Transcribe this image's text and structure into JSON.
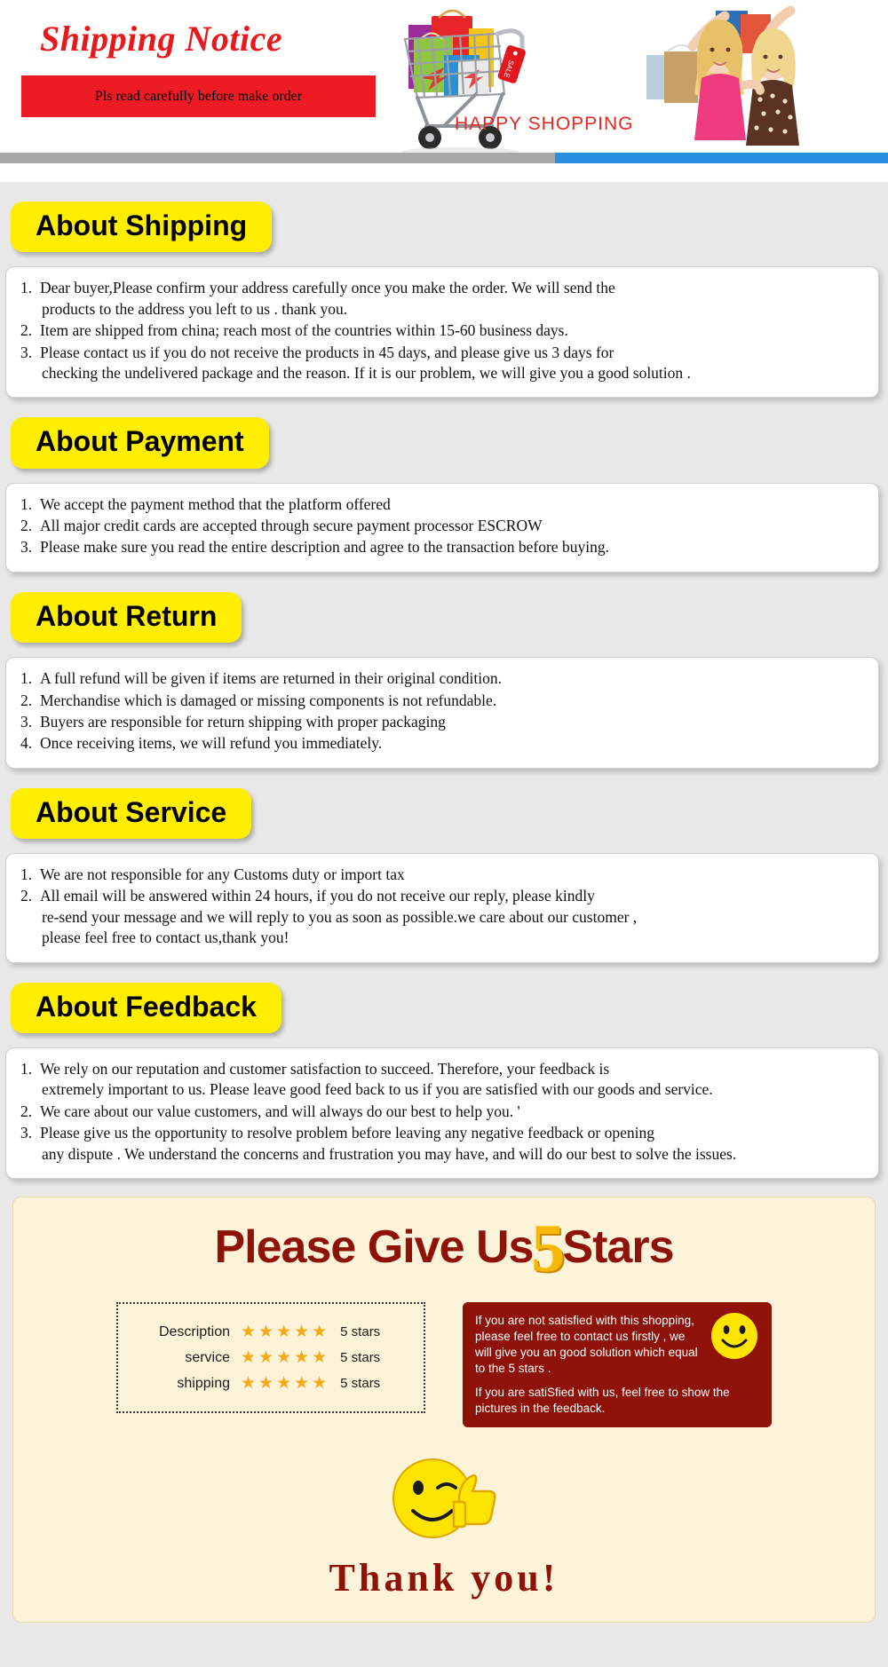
{
  "header": {
    "title": "Shipping Notice",
    "banner_text": "Pls read carefully before make order",
    "happy_shopping": "HAPPY SHOPPING",
    "sale_tag": "SALE",
    "colors": {
      "title_red": "#e8191c",
      "banner_red": "#ed1c24",
      "strip_grey": "#a8a8a8",
      "strip_blue": "#2a8fe0"
    }
  },
  "sections": [
    {
      "heading": "About Shipping",
      "items": [
        [
          "Dear buyer,Please confirm your address carefully once you make the order. We will send the",
          "products to the address you left to us . thank you."
        ],
        [
          "Item are shipped from china; reach most of the countries within 15-60 business days."
        ],
        [
          "Please contact us if you do not receive the products in 45 days, and please give us 3 days for",
          "checking the undelivered package and the reason. If it is our problem, we will give you a good solution ."
        ]
      ]
    },
    {
      "heading": "About Payment",
      "items": [
        [
          "We accept the payment method that the platform offered"
        ],
        [
          "All major credit cards are accepted through secure payment processor ESCROW"
        ],
        [
          "Please make sure you read the entire description and agree to the transaction before buying."
        ]
      ]
    },
    {
      "heading": "About Return",
      "items": [
        [
          "A full refund will be given if items are returned in their original condition."
        ],
        [
          "Merchandise which is damaged or missing components is not refundable."
        ],
        [
          "Buyers are responsible for return shipping with proper packaging"
        ],
        [
          "Once receiving items, we will refund you immediately."
        ]
      ]
    },
    {
      "heading": "About Service",
      "items": [
        [
          "We are not responsible for any Customs duty or import tax"
        ],
        [
          "All email will be answered within 24 hours, if you do not receive our reply, please kindly",
          "re-send your message and we will reply to you as soon as possible.we care about our customer ,",
          "please feel free to contact us,thank you!"
        ]
      ]
    },
    {
      "heading": "About Feedback",
      "items": [
        [
          "We rely on our reputation and customer satisfaction to succeed. Therefore, your feedback is",
          "extremely important to us. Please leave good feed back to us if you are satisfied with our goods and service."
        ],
        [
          "We care about our value customers, and will always do our best to help you. '"
        ],
        [
          "Please give us the opportunity to resolve problem before leaving any negative feedback or opening",
          "any dispute . We understand the concerns and frustration you may have, and will do our best to solve the issues."
        ]
      ]
    }
  ],
  "stars_panel": {
    "headline_before": "Please Give Us",
    "headline_number": "5",
    "headline_after": "Stars",
    "ratings": [
      {
        "label": "Description",
        "stars": "★★★★★",
        "value": "5 stars"
      },
      {
        "label": "service",
        "stars": "★★★★★",
        "value": "5 stars"
      },
      {
        "label": "shipping",
        "stars": "★★★★★",
        "value": "5 stars"
      }
    ],
    "promise_line1": "If you are not satisfied with this shopping, please feel free to contact us firstly , we will give you an good solution which equal to the 5 stars .",
    "promise_line2": "If you are satiSfied with us, feel free to show the pictures in the feedback.",
    "thank_you": "Thank  you!",
    "colors": {
      "panel_bg": "#fdf3d8",
      "dark_red": "#8f1208",
      "gold": "#f5b80a",
      "star_gold": "#f4a91b"
    }
  }
}
